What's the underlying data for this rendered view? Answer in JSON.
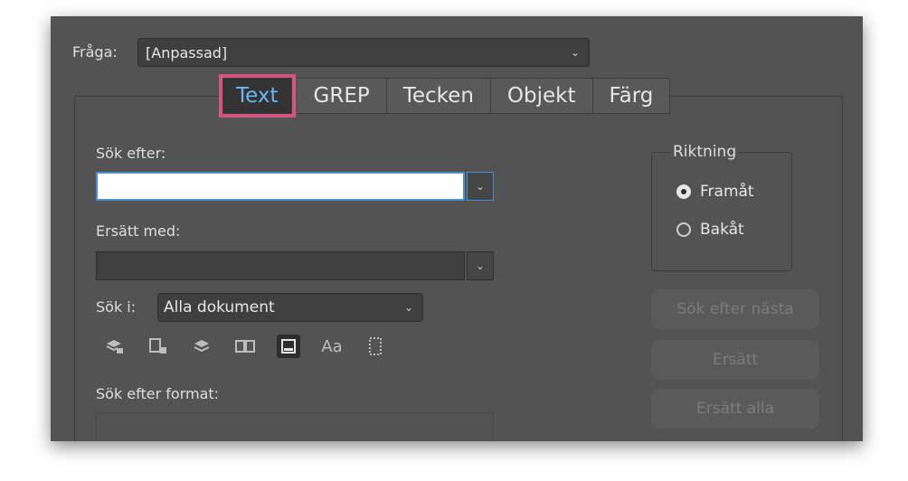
{
  "query": {
    "label": "Fråga:",
    "value": "[Anpassad]"
  },
  "tabs": [
    {
      "label": "Text",
      "active": true
    },
    {
      "label": "GREP",
      "active": false
    },
    {
      "label": "Tecken",
      "active": false
    },
    {
      "label": "Objekt",
      "active": false
    },
    {
      "label": "Färg",
      "active": false
    }
  ],
  "find": {
    "label": "Sök efter:",
    "value": ""
  },
  "replace": {
    "label": "Ersätt med:",
    "value": ""
  },
  "search_in": {
    "label": "Sök i:",
    "value": "Alla dokument"
  },
  "option_icons": [
    "lock-layer-icon",
    "lock-item-icon",
    "hidden-layer-icon",
    "master-page-icon",
    "footnote-icon",
    "case-sensitive-icon",
    "whole-word-icon"
  ],
  "case_label": "Aa",
  "format": {
    "label": "Sök efter format:"
  },
  "direction": {
    "title": "Riktning",
    "forward": "Framåt",
    "backward": "Bakåt",
    "selected": "forward"
  },
  "buttons": {
    "find_next": "Sök efter nästa",
    "replace": "Ersätt",
    "replace_all": "Ersätt alla"
  },
  "colors": {
    "dialog_bg": "#535353",
    "active_tab_text": "#6fb4f2",
    "highlight": "#d2567f",
    "focus_border": "#4a8fd6"
  }
}
